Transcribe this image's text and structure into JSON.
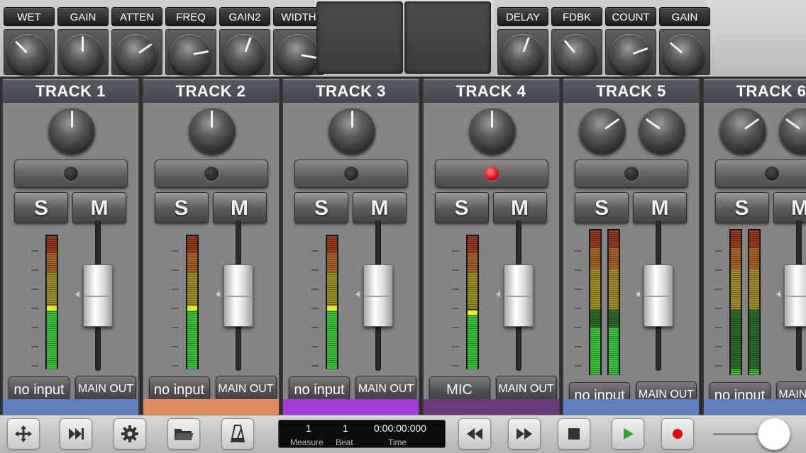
{
  "fx_left": {
    "labels": [
      "WET",
      "GAIN",
      "ATTEN",
      "FREQ",
      "GAIN2",
      "WIDTH"
    ],
    "knob_angles_deg": [
      -45,
      0,
      55,
      80,
      20,
      100
    ]
  },
  "fx_right": {
    "labels": [
      "DELAY",
      "FDBK",
      "COUNT",
      "GAIN"
    ],
    "knob_angles_deg": [
      20,
      -40,
      70,
      -50
    ]
  },
  "tracks": [
    {
      "title": "TRACK 1",
      "solo_label": "S",
      "mute_label": "M",
      "input_label": "no input",
      "output_label": "MAIN OUT",
      "record_armed": false,
      "strip_color": "#5e7fc0",
      "knobs": 1,
      "meter_level": 0.45,
      "meter_peak": 0.45,
      "stereo": false,
      "fader_level": 0.7
    },
    {
      "title": "TRACK 2",
      "solo_label": "S",
      "mute_label": "M",
      "input_label": "no input",
      "output_label": "MAIN OUT",
      "record_armed": false,
      "strip_color": "#e08a60",
      "knobs": 1,
      "meter_level": 0.45,
      "meter_peak": 0.45,
      "stereo": false,
      "fader_level": 0.7
    },
    {
      "title": "TRACK 3",
      "solo_label": "S",
      "mute_label": "M",
      "input_label": "no input",
      "output_label": "MAIN OUT",
      "record_armed": false,
      "strip_color": "#a43ad8",
      "knobs": 1,
      "meter_level": 0.45,
      "meter_peak": 0.45,
      "stereo": false,
      "fader_level": 0.7
    },
    {
      "title": "TRACK 4",
      "solo_label": "S",
      "mute_label": "M",
      "input_label": "MIC",
      "output_label": "MAIN OUT",
      "record_armed": true,
      "strip_color": "#6a3a7a",
      "knobs": 1,
      "meter_level": 0.42,
      "meter_peak": 0.42,
      "stereo": false,
      "fader_level": 0.7
    },
    {
      "title": "TRACK 5",
      "solo_label": "S",
      "mute_label": "M",
      "input_label": "no input",
      "output_label": "MAIN OUT",
      "record_armed": false,
      "strip_color": "#5e7fc0",
      "knobs": 2,
      "meter_level": 0.33,
      "meter_peak": 0.33,
      "stereo": true,
      "fader_level": 0.7
    },
    {
      "title": "TRACK 6",
      "solo_label": "S",
      "mute_label": "M",
      "input_label": "no input",
      "output_label": "MAIN OUT",
      "record_armed": false,
      "strip_color": "#5e7fc0",
      "knobs": 2,
      "meter_level": 0.04,
      "meter_peak": 0.04,
      "stereo": true,
      "fader_level": 0.7
    }
  ],
  "transport": {
    "measure_value": "1",
    "beat_value": "1",
    "time_value": "0:00:00:000",
    "measure_label": "Measure",
    "beat_label": "Beat",
    "time_label": "Time",
    "volume_level": 0.95
  },
  "colors": {
    "play": "#2ea82e",
    "record": "#e01010"
  }
}
